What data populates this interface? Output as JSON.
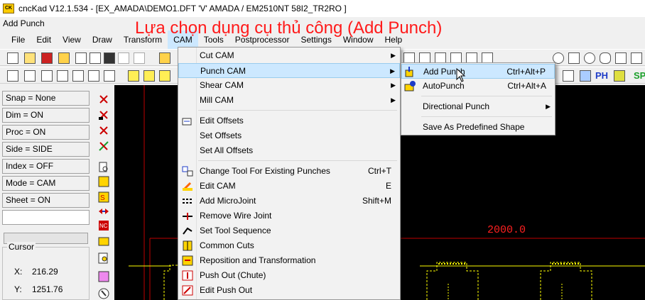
{
  "window": {
    "title": "cncKad V12.1.534 - [EX_AMADA\\DEMO1.DFT  'V'  AMADA / EM2510NT  58I2_TR2RO  ]",
    "command": "Add Punch"
  },
  "annotation": "Lựa chọn dụng cụ thủ công (Add Punch)",
  "menubar": [
    "File",
    "Edit",
    "View",
    "Draw",
    "Transform",
    "CAM",
    "Tools",
    "Postprocessor",
    "Settings",
    "Window",
    "Help"
  ],
  "status": [
    "Snap = None",
    "Dim = ON",
    "Proc = ON",
    "Side = SIDE",
    "Index = OFF",
    "Mode = CAM",
    "Sheet = ON"
  ],
  "cursor": {
    "title": "Cursor",
    "x_label": "X:",
    "x_value": "216.29",
    "y_label": "Y:",
    "y_value": "1251.76"
  },
  "canvas": {
    "dimension": "2000.0"
  },
  "cam_menu": [
    {
      "label": "Cut CAM",
      "shortcut": "",
      "sub": true
    },
    {
      "label": "Punch CAM",
      "shortcut": "",
      "sub": true
    },
    {
      "label": "Shear CAM",
      "shortcut": "",
      "sub": true
    },
    {
      "label": "Mill CAM",
      "shortcut": "",
      "sub": true
    },
    {
      "label": "Edit Offsets",
      "shortcut": ""
    },
    {
      "label": "Set Offsets",
      "shortcut": ""
    },
    {
      "label": "Set All Offsets",
      "shortcut": ""
    },
    {
      "label": "Change Tool For Existing Punches",
      "shortcut": "Ctrl+T"
    },
    {
      "label": "Edit CAM",
      "shortcut": "E"
    },
    {
      "label": "Add MicroJoint",
      "shortcut": "Shift+M"
    },
    {
      "label": "Remove Wire Joint",
      "shortcut": ""
    },
    {
      "label": "Set Tool Sequence",
      "shortcut": ""
    },
    {
      "label": "Common Cuts",
      "shortcut": ""
    },
    {
      "label": "Reposition and Transformation",
      "shortcut": ""
    },
    {
      "label": "Push Out (Chute)",
      "shortcut": ""
    },
    {
      "label": "Edit Push Out",
      "shortcut": ""
    }
  ],
  "punch_submenu": [
    {
      "label": "Add Punch",
      "shortcut": "Ctrl+Alt+P"
    },
    {
      "label": "AutoPunch",
      "shortcut": "Ctrl+Alt+A"
    },
    {
      "label": "Directional Punch",
      "shortcut": "",
      "sub": true
    },
    {
      "label": "Save As Predefined Shape",
      "shortcut": ""
    }
  ],
  "toolbar": {
    "ph_label": "PH",
    "sp_label": "SP"
  },
  "colors": {
    "canvas": "#000000",
    "dim_text": "#ff2020",
    "highlight": "#cce8ff",
    "annotation": "#ff1a1a",
    "geometry": "#ffff00"
  }
}
